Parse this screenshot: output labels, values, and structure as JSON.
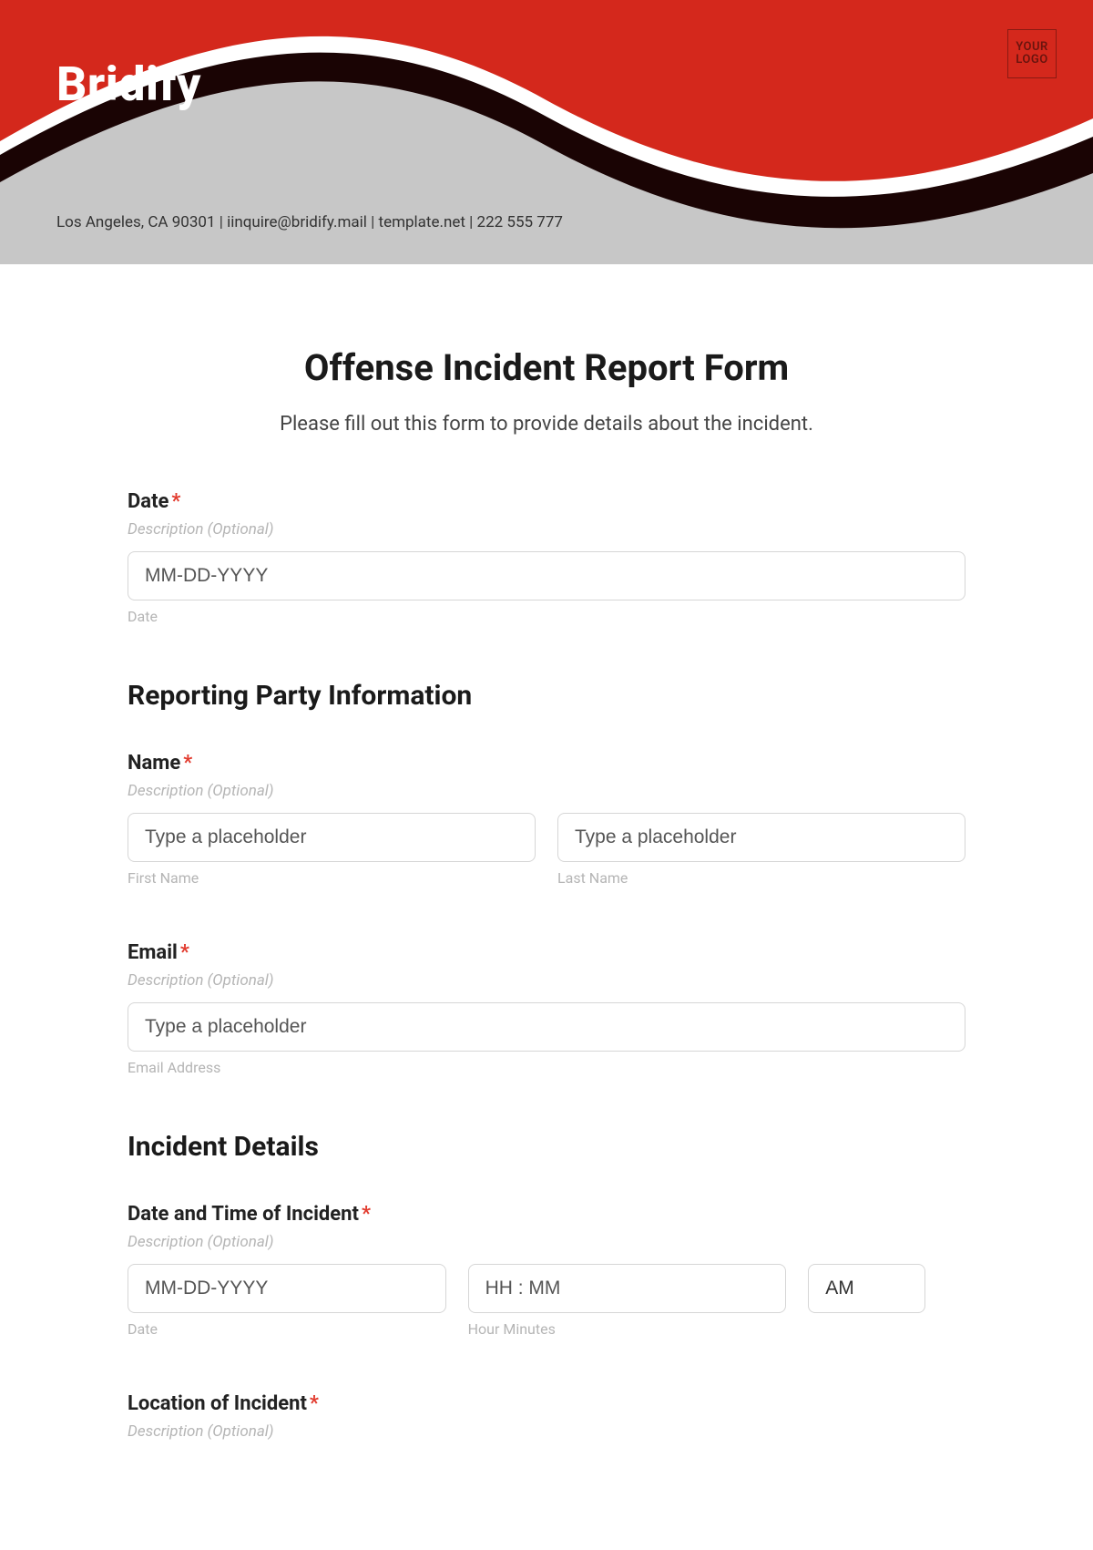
{
  "header": {
    "brand": "Bridify",
    "logo_text": "YOUR LOGO",
    "contact": "Los Angeles, CA 90301 | iinquire@bridify.mail | template.net | 222 555 777"
  },
  "form": {
    "title": "Offense Incident Report Form",
    "subtitle": "Please fill out this form to provide details about the incident.",
    "required_mark": "*",
    "desc_text": "Description (Optional)",
    "date": {
      "label": "Date",
      "placeholder": "MM-DD-YYYY",
      "sublabel": "Date"
    },
    "section_reporting": "Reporting Party Information",
    "name": {
      "label": "Name",
      "first_placeholder": "Type a placeholder",
      "last_placeholder": "Type a placeholder",
      "first_sub": "First Name",
      "last_sub": "Last Name"
    },
    "email": {
      "label": "Email",
      "placeholder": "Type a placeholder",
      "sublabel": "Email Address"
    },
    "section_incident": "Incident Details",
    "datetime": {
      "label": "Date and Time of Incident",
      "date_placeholder": "MM-DD-YYYY",
      "time_placeholder": "HH : MM",
      "ampm_value": "AM",
      "date_sub": "Date",
      "time_sub": "Hour Minutes"
    },
    "location": {
      "label": "Location of Incident"
    }
  }
}
